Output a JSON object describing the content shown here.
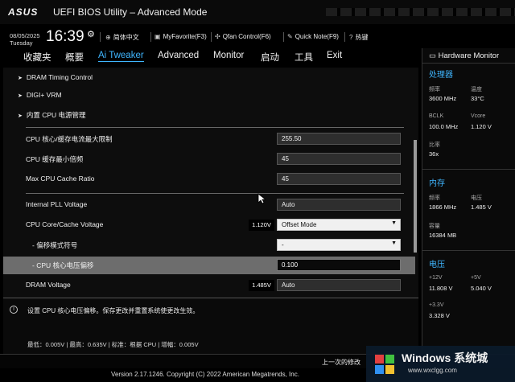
{
  "window": {
    "logo": "ASUS",
    "title": "UEFI BIOS Utility – Advanced Mode"
  },
  "infobar": {
    "date": "08/05/2025",
    "day": "Tuesday",
    "time": "16:39",
    "tools": [
      {
        "icon": "globe-icon",
        "label": "简体中文"
      },
      {
        "icon": "favorite-icon",
        "label": "MyFavorite(F3)"
      },
      {
        "icon": "fan-icon",
        "label": "Qfan Control(F6)"
      },
      {
        "icon": "note-icon",
        "label": "Quick Note(F9)"
      },
      {
        "icon": "hotkey-icon",
        "label": "热键"
      }
    ]
  },
  "nav": {
    "tabs": [
      "收藏夹",
      "概要",
      "Ai Tweaker",
      "Advanced",
      "Monitor",
      "启动",
      "工具",
      "Exit"
    ],
    "active": "Ai Tweaker"
  },
  "menu": {
    "groups": [
      "DRAM Timing Control",
      "DIGI+ VRM",
      "内置 CPU 电源管理"
    ],
    "settings": [
      {
        "label": "CPU 核心/缓存电流最大限制",
        "value": "255.50"
      },
      {
        "label": "CPU 缓存最小倍频",
        "value": "45"
      },
      {
        "label": "Max CPU Cache Ratio",
        "value": "45"
      },
      {
        "label": "Internal PLL Voltage",
        "value": "Auto"
      },
      {
        "label": "CPU Core/Cache Voltage",
        "current": "1.120V",
        "value": "Offset Mode"
      },
      {
        "label": "- 偏移模式符号",
        "value": "-"
      },
      {
        "label": "- CPU 核心电压偏移",
        "value": "0.100"
      },
      {
        "label": "DRAM Voltage",
        "current": "1.485V",
        "value": "Auto"
      }
    ]
  },
  "help": {
    "icon": "info-icon",
    "text": "设置 CPU 核心电压偏移。保存更改并重置系统使更改生效。",
    "limits": "最低：0.005V  |  最高：0.635V  |  标准：根据 CPU  |  增幅：0.005V"
  },
  "hw": {
    "title": "Hardware Monitor",
    "cpu_header": "处理器",
    "freq_label": "频率",
    "freq": "3600 MHz",
    "temp_label": "温度",
    "temp": "33°C",
    "bclk_label": "BCLK",
    "bclk": "100.0 MHz",
    "vcore_label": "Vcore",
    "vcore": "1.120 V",
    "ratio_label": "比率",
    "ratio": "36x",
    "mem_header": "内存",
    "mem_freq_label": "频率",
    "mem_freq": "1866 MHz",
    "mem_volt_label": "电压",
    "mem_volt": "1.485 V",
    "cap_label": "容量",
    "cap": "16384 MB",
    "volt_header": "电压",
    "v12_label": "+12V",
    "v12": "11.808 V",
    "v5_label": "+5V",
    "v5": "5.040 V",
    "v33_label": "+3.3V",
    "v33": "3.328 V"
  },
  "footer": {
    "last_modified": "上一次的修改",
    "version": "Version 2.17.1246. Copyright (C) 2022 American Megatrends, Inc."
  },
  "watermark": {
    "text": "Windows 系统城",
    "url": "www.wxclgg.com"
  },
  "colors": {
    "accent": "#3fb6ff",
    "selected_row": "#6d6d6d"
  }
}
